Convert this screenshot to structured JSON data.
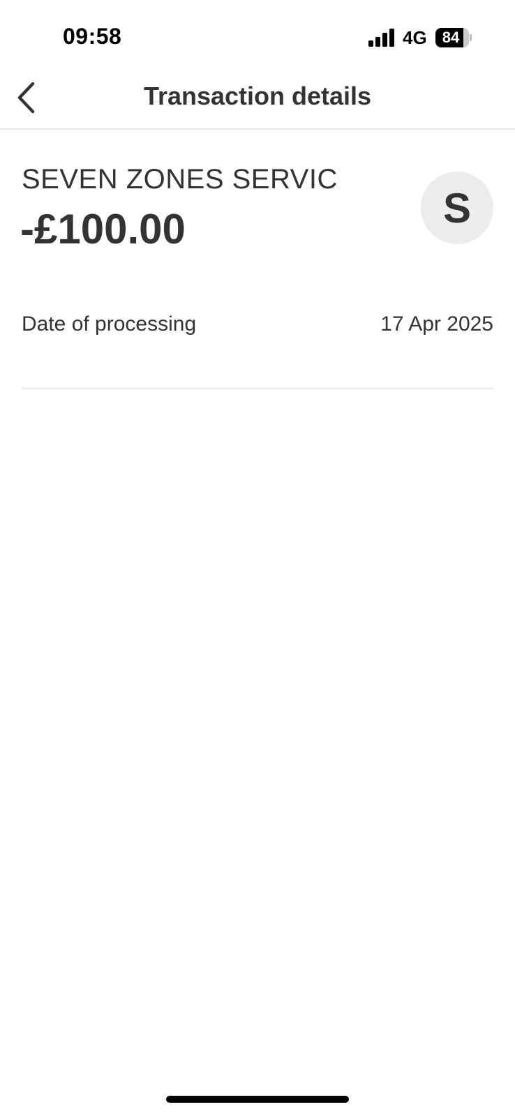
{
  "status_bar": {
    "time": "09:58",
    "network": "4G",
    "battery_level": "84",
    "battery_fraction": 0.84,
    "signal_bars": 4
  },
  "header": {
    "title": "Transaction details"
  },
  "transaction": {
    "merchant": "SEVEN ZONES SERVIC",
    "amount": "-£100.00",
    "avatar_letter": "S"
  },
  "details": [
    {
      "label": "Date of processing",
      "value": "17 Apr 2025"
    }
  ],
  "icons": {
    "back": "chevron-left-icon",
    "signal": "cellular-signal-icon",
    "battery": "battery-icon"
  },
  "colors": {
    "text": "#333333",
    "avatar_bg": "#ececec",
    "divider": "#e4e4e4"
  }
}
